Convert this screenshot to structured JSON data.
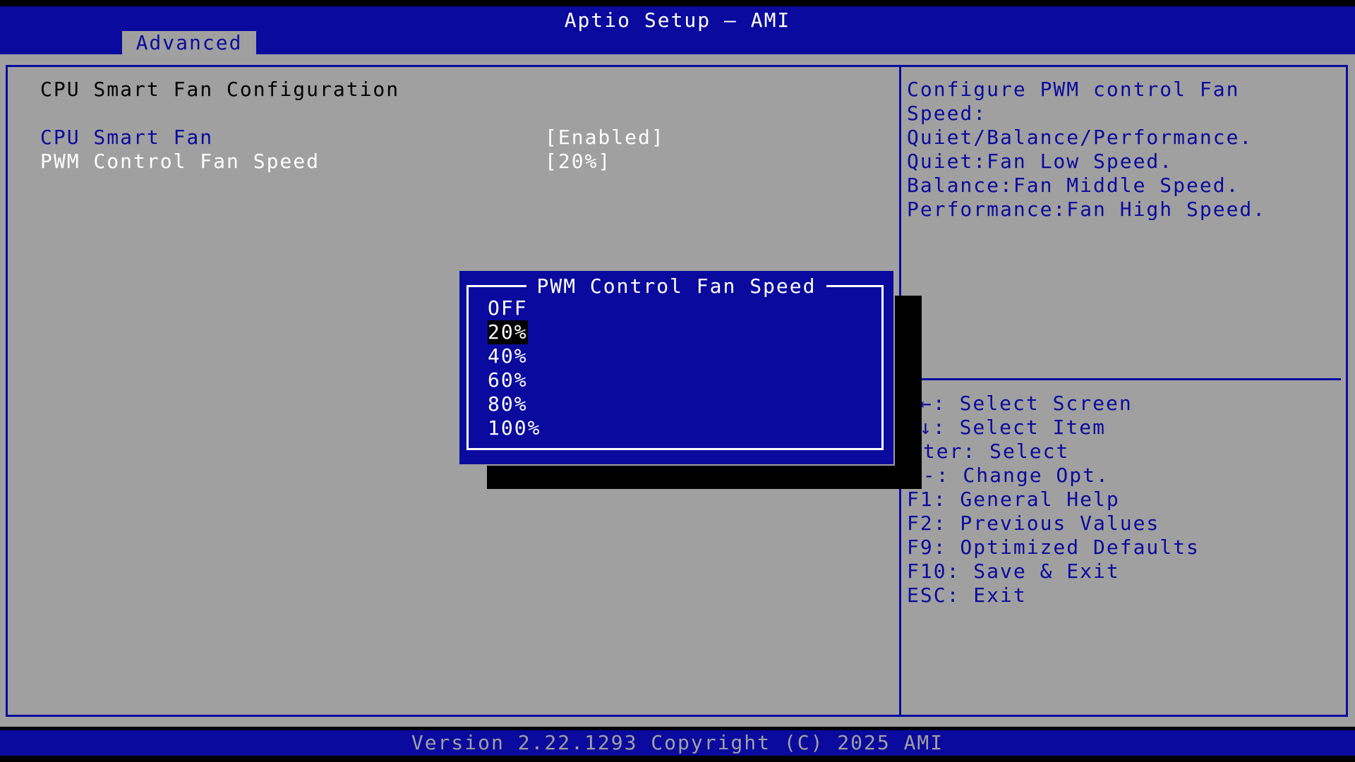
{
  "app": {
    "title": "Aptio Setup – AMI"
  },
  "tabs": [
    {
      "label": "Advanced",
      "active": true
    }
  ],
  "page": {
    "heading": "CPU Smart Fan Configuration",
    "settings": [
      {
        "label": "CPU Smart Fan",
        "value": "[Enabled]"
      },
      {
        "label": "PWM Control Fan Speed",
        "value": "[20%]"
      }
    ]
  },
  "help": {
    "lines": [
      "Configure PWM control Fan",
      "Speed:",
      "Quiet/Balance/Performance.",
      "Quiet:Fan Low Speed.",
      "Balance:Fan Middle Speed.",
      "Performance:Fan High Speed."
    ]
  },
  "keys": {
    "lines": [
      "←: Select Screen",
      "↓: Select Item",
      "nter: Select",
      "/-: Change Opt.",
      "F1: General Help",
      "F2: Previous Values",
      "F9: Optimized Defaults",
      "F10: Save & Exit",
      "ESC: Exit"
    ]
  },
  "dialog": {
    "title": "PWM Control Fan Speed",
    "options": [
      "OFF",
      "20%",
      "40%",
      "60%",
      "80%",
      "100%"
    ],
    "selected": "20%"
  },
  "footer": {
    "text": "Version 2.22.1293 Copyright (C) 2025 AMI"
  },
  "colors": {
    "navy": "#0a0a9e",
    "gray": "#a0a0a0",
    "white": "#ffffff",
    "black": "#000000"
  }
}
